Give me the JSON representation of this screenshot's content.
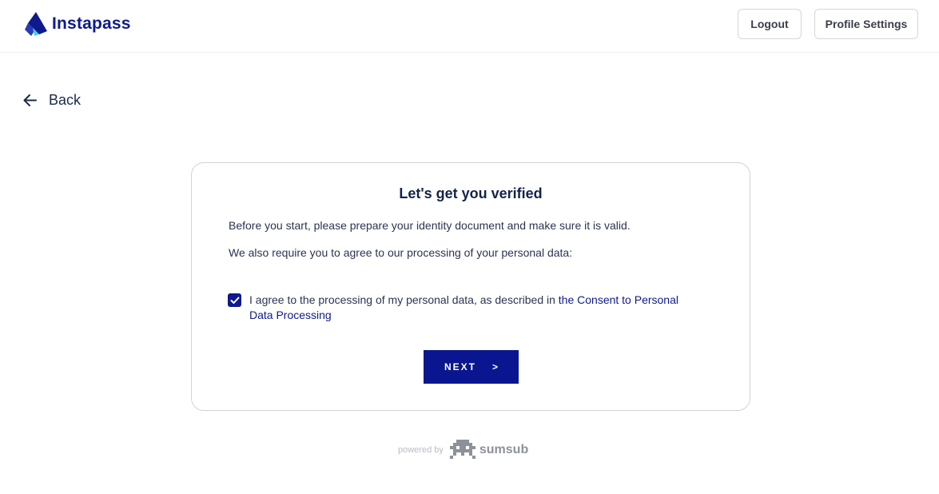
{
  "header": {
    "brand": "Instapass",
    "logout_label": "Logout",
    "profile_label": "Profile Settings"
  },
  "nav": {
    "back_label": "Back"
  },
  "card": {
    "title": "Let's get you verified",
    "paragraph1": "Before you start, please prepare your identity document and make sure it is valid.",
    "paragraph2": "We also require you to agree to our processing of your personal data:",
    "consent_prefix": "I agree to the processing of my personal data, as described in ",
    "consent_link": "the Consent to Personal Data Processing",
    "consent_checked": true,
    "next_label": "NEXT",
    "next_chevron": ">"
  },
  "footer": {
    "powered_label": "powered by",
    "provider": "sumsub"
  },
  "colors": {
    "brand": "#0e1a8c",
    "button": "#0a1590",
    "text": "#2b3550"
  }
}
